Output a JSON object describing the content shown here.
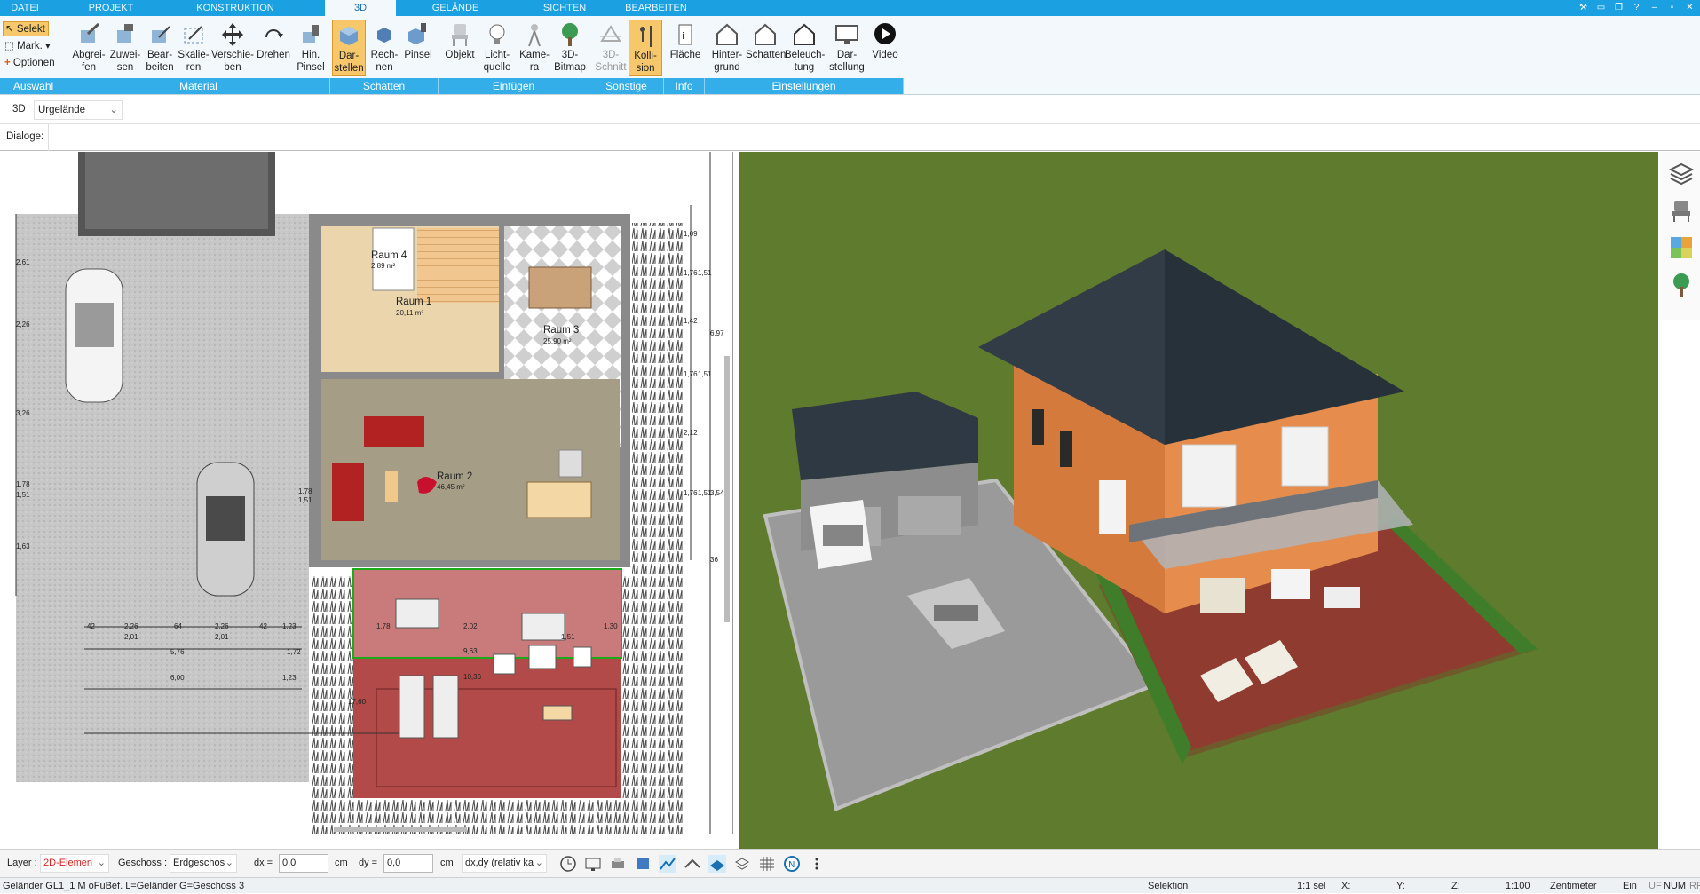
{
  "tabs": [
    "DATEI",
    "PROJEKT",
    "KONSTRUKTION",
    "3D",
    "GELÄNDE",
    "SICHTEN",
    "BEARBEITEN"
  ],
  "active_tab": "3D",
  "left_tools": [
    "Selekt",
    "Mark.",
    "Optionen"
  ],
  "ribbon": {
    "buttons": [
      "Abgrei-\nfen",
      "Zuwei-\nsen",
      "Bear-\nbeiten",
      "Skalie-\nren",
      "Verschie-\nben",
      "Drehen",
      "Hin.\nPinsel",
      "Dar-\nstellen",
      "Rech-\nnen",
      "Pinsel",
      "Objekt",
      "Licht-\nquelle",
      "Kame-\nra",
      "3D-\nBitmap",
      "3D-\nSchnitt",
      "Kolli-\nsion",
      "Fläche",
      "Hinter-\ngrund",
      "Schatten",
      "Beleuch-\ntung",
      "Dar-\nstellung",
      "Video"
    ],
    "groups": [
      "Auswahl",
      "Material",
      "Schatten",
      "Einfügen",
      "Sonstige",
      "Info",
      "Einstellungen"
    ]
  },
  "view_bar": {
    "mode": "3D",
    "terrain": "Urgelände"
  },
  "dialog_label": "Dialoge:",
  "plan": {
    "rooms": [
      {
        "name": "Raum 4",
        "area": "2,89 m²"
      },
      {
        "name": "Raum 1",
        "area": "20,11 m²"
      },
      {
        "name": "Raum 3",
        "area": "25,90 m²"
      },
      {
        "name": "Raum 2",
        "area": "46,45 m²"
      }
    ],
    "dims": [
      "2,26",
      "2,26",
      "2,01",
      "2,01",
      "5,76",
      "6,00",
      "1,72",
      "1,23",
      "1,23",
      "1,78",
      "2,02",
      "1,51",
      "1,30",
      "9,63",
      "10,36",
      "17,60",
      "42",
      "64",
      "42",
      "1,78",
      "1,51",
      "3,26",
      "2,61",
      "2,26",
      "1,51",
      "1,78",
      "1,63",
      "1,09",
      "1,51",
      "1,76",
      "1,42",
      "6,97",
      "1,51",
      "1,76",
      "2,12",
      "3,54",
      "1,51",
      "1,76",
      "36"
    ]
  },
  "bottom": {
    "layer_label": "Layer :",
    "layer_value": "2D-Elemen",
    "geschoss_label": "Geschoss :",
    "geschoss_value": "Erdgeschos",
    "dx_label": "dx =",
    "dx_value": "0,0",
    "dy_label": "dy =",
    "dy_value": "0,0",
    "unit": "cm",
    "mode_value": "dx,dy (relativ ka"
  },
  "status": {
    "left": "Geländer GL1_1 M oFuBef. L=Geländer G=Geschoss 3",
    "mode": "Selektion",
    "sel": "1:1 sel",
    "x": "X:",
    "y": "Y:",
    "z": "Z:",
    "scale": "1:100",
    "unit": "Zentimeter",
    "ein": "Ein",
    "uf": "UF",
    "num": "NUM",
    "rf": "RF"
  },
  "colors": {
    "accent": "#1ba1e2",
    "group": "#33aee8",
    "active": "#f6c76b",
    "grass": "#5e7a2e",
    "roof": "#2f3a44",
    "facade": "#e08a4a"
  }
}
